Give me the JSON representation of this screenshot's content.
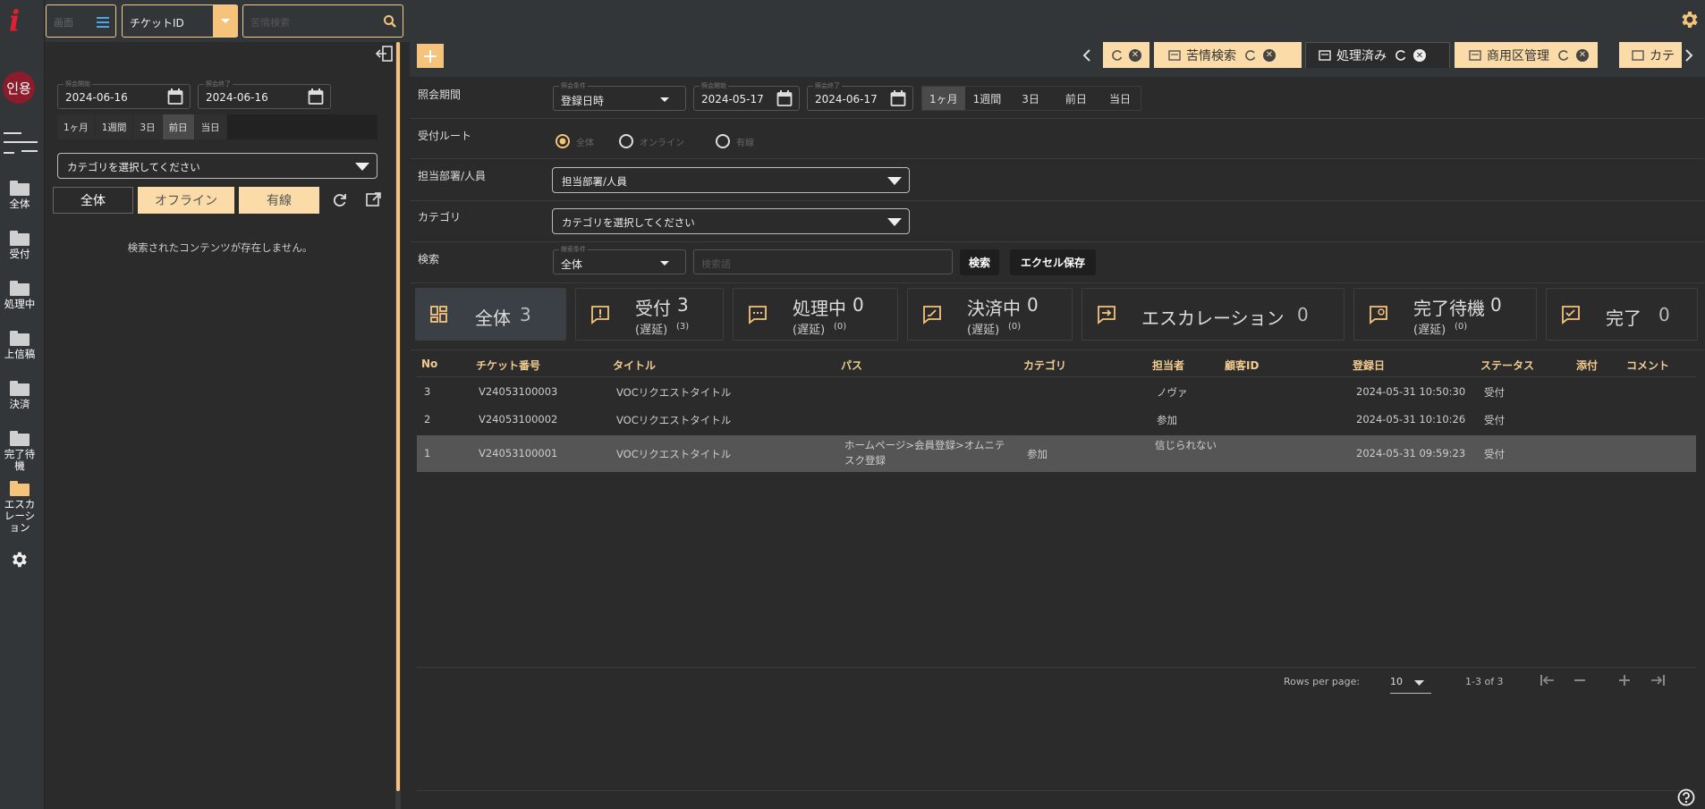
{
  "rail": {
    "logo": "i",
    "avatar": "인용",
    "items": [
      {
        "label": "全体"
      },
      {
        "label": "受付"
      },
      {
        "label": "処理中"
      },
      {
        "label": "上信稿"
      },
      {
        "label": "決済"
      },
      {
        "label": "完了待機"
      },
      {
        "label": "エスカレーション"
      }
    ]
  },
  "topbar": {
    "view_select": "画面",
    "search_type": "チケットID",
    "search_placeholder": "苦情検索"
  },
  "left": {
    "start_label": "照会開始",
    "start_date": "2024-06-16",
    "end_label": "照会終了",
    "end_date": "2024-06-16",
    "ranges": [
      "1ヶ月",
      "1週間",
      "3日",
      "前日",
      "当日"
    ],
    "active_range": "前日",
    "category_placeholder": "カテゴリを選択してください",
    "filter_tabs": [
      "全体",
      "オフライン",
      "有線"
    ],
    "empty_message": "検索されたコンテンツが存在しません。"
  },
  "tabs": [
    {
      "label": "苦情検索"
    },
    {
      "label": "処理済み"
    },
    {
      "label": "商用区管理"
    },
    {
      "label": "カテ"
    }
  ],
  "filters": {
    "period_label": "照会期間",
    "period_type_label": "照会条件",
    "period_type": "登録日時",
    "start_label": "照会開始",
    "start_date": "2024-05-17",
    "end_label": "照会終了",
    "end_date": "2024-06-17",
    "ranges": [
      "1ヶ月",
      "1週間",
      "3日",
      "前日",
      "当日"
    ],
    "active_range": "1ヶ月",
    "route_label": "受付ルート",
    "routes": [
      "全体",
      "オンライン",
      "有線"
    ],
    "dept_label": "担当部署/人員",
    "dept_placeholder": "担当部署/人員",
    "category_label": "カテゴリ",
    "category_placeholder": "カテゴリを選択してください",
    "search_label": "検索",
    "search_cond_label": "検索条件",
    "search_cond": "全体",
    "search_placeholder": "検索語",
    "search_button": "検索",
    "excel_button": "エクセル保存"
  },
  "stats": [
    {
      "label": "全体",
      "count": "3"
    },
    {
      "label": "受付",
      "count": "3",
      "sub": "(遅延)",
      "sub_count": "(3)"
    },
    {
      "label": "処理中",
      "count": "0",
      "sub": "(遅延)",
      "sub_count": "(0)"
    },
    {
      "label": "決済中",
      "count": "0",
      "sub": "(遅延)",
      "sub_count": "(0)"
    },
    {
      "label": "エスカレーション",
      "count": "0"
    },
    {
      "label": "完了待機",
      "count": "0",
      "sub": "(遅延)",
      "sub_count": "(0)"
    },
    {
      "label": "完了",
      "count": "0"
    }
  ],
  "table": {
    "headers": [
      "No",
      "チケット番号",
      "タイトル",
      "パス",
      "カテゴリ",
      "担当者",
      "顧客ID",
      "登録日",
      "ステータス",
      "添付",
      "コメント"
    ],
    "rows": [
      {
        "no": "3",
        "ticket": "V24053100003",
        "title": "VOCリクエストタイトル",
        "path": "",
        "category": "",
        "assignee": "ノヴァ",
        "customer": "",
        "date": "2024-05-31 10:50:30",
        "status": "受付"
      },
      {
        "no": "2",
        "ticket": "V24053100002",
        "title": "VOCリクエストタイトル",
        "path": "",
        "category": "",
        "assignee": "参加",
        "customer": "",
        "date": "2024-05-31 10:10:26",
        "status": "受付"
      },
      {
        "no": "1",
        "ticket": "V24053100001",
        "title": "VOCリクエストタイトル",
        "path": "ホームページ>会員登録>オムニテスク登録",
        "category": "参加",
        "assignee": "信じられない",
        "customer": "",
        "date": "2024-05-31 09:59:23",
        "status": "受付"
      }
    ]
  },
  "pagination": {
    "rows_label": "Rows per page:",
    "rows_value": "10",
    "range": "1-3 of 3"
  },
  "colors": {
    "accent": "#f5c37b",
    "tab_bg": "#fbdba8",
    "logo": "#e0202e"
  }
}
